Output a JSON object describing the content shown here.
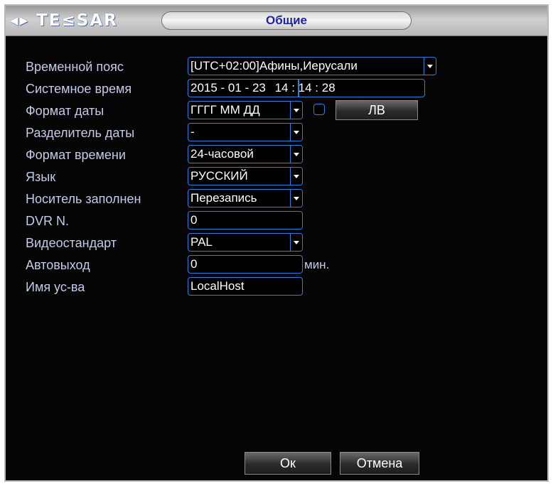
{
  "window": {
    "brand": "◂▸ TE≤SAR",
    "title": "Общие"
  },
  "fields": {
    "timezone": {
      "label": "Временной пояс",
      "value": "[UTC+02:00]Афины,Иерусали"
    },
    "system_time": {
      "label": "Системное время",
      "date": "2015 - 01 - 23",
      "time": "14 : 14 : 28"
    },
    "date_format": {
      "label": "Формат даты",
      "value": "ГГГГ ММ ДД",
      "dst_button": "ЛВ"
    },
    "date_separator": {
      "label": "Разделитель даты",
      "value": "-"
    },
    "time_format": {
      "label": "Формат времени",
      "value": "24-часовой"
    },
    "language": {
      "label": "Язык",
      "value": "РУССКИЙ"
    },
    "storage_full": {
      "label": "Носитель заполнен",
      "value": "Перезапись"
    },
    "dvr_no": {
      "label": "DVR N.",
      "value": "0"
    },
    "video_standard": {
      "label": "Видеостандарт",
      "value": "PAL"
    },
    "auto_logout": {
      "label": "Автовыход",
      "value": "0",
      "unit": "мин."
    },
    "device_name": {
      "label": "Имя ус-ва",
      "value": "LocalHost"
    }
  },
  "buttons": {
    "ok": "Ок",
    "cancel": "Отмена"
  },
  "colors": {
    "accent": "#2f7fe0",
    "label_text": "#c4cbe8",
    "background": "#050505",
    "title_text": "#1d22a6"
  }
}
